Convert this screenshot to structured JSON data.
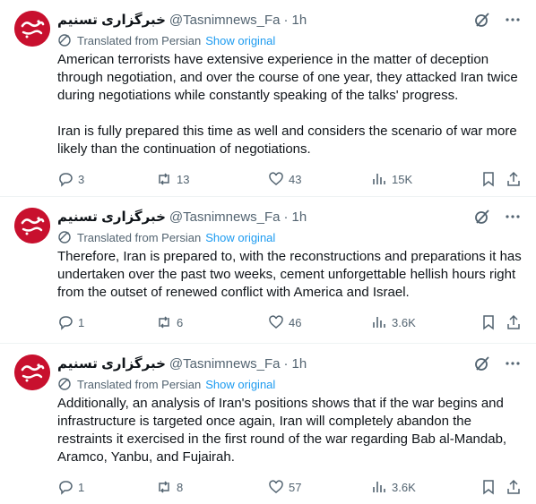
{
  "tweets": [
    {
      "name": "خبرگزاری تسنیم",
      "handle": "@Tasnimnews_Fa",
      "time": "1h",
      "translated_label": "Translated from Persian",
      "show_original": "Show original",
      "text": "American terrorists have extensive experience in the matter of deception through negotiation, and over the course of one year, they attacked Iran twice during negotiations while constantly speaking of the talks' progress.\n\nIran is fully prepared this time as well and considers the scenario of war more likely than the continuation of negotiations.",
      "replies": "3",
      "reposts": "13",
      "likes": "43",
      "views": "15K"
    },
    {
      "name": "خبرگزاری تسنیم",
      "handle": "@Tasnimnews_Fa",
      "time": "1h",
      "translated_label": "Translated from Persian",
      "show_original": "Show original",
      "text": "Therefore, Iran is prepared to, with the reconstructions and preparations it has undertaken over the past two weeks, cement unforgettable hellish hours right from the outset of renewed conflict with America and Israel.",
      "replies": "1",
      "reposts": "6",
      "likes": "46",
      "views": "3.6K"
    },
    {
      "name": "خبرگزاری تسنیم",
      "handle": "@Tasnimnews_Fa",
      "time": "1h",
      "translated_label": "Translated from Persian",
      "show_original": "Show original",
      "text": "Additionally, an analysis of Iran's positions shows that if the war begins and infrastructure is targeted once again, Iran will completely abandon the restraints it exercised in the first round of the war regarding Bab al-Mandab, Aramco, Yanbu, and Fujairah.",
      "replies": "1",
      "reposts": "8",
      "likes": "57",
      "views": "3.6K"
    }
  ],
  "separator": "·",
  "colors": {
    "text": "#0f1419",
    "muted": "#536471",
    "link": "#1d9bf0",
    "avatar": "#c8102e",
    "border": "#eff3f4"
  },
  "icons": [
    "grok-icon",
    "more-icon",
    "translate-icon",
    "reply-icon",
    "repost-icon",
    "like-icon",
    "views-icon",
    "bookmark-icon",
    "share-icon"
  ]
}
